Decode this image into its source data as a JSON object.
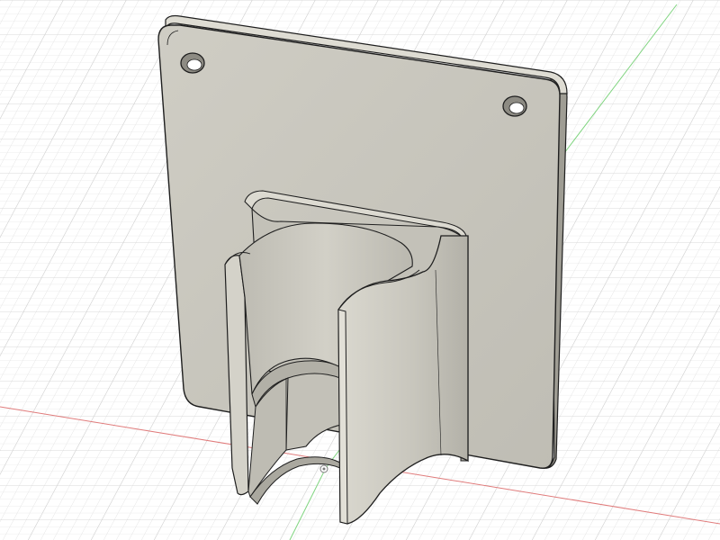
{
  "viewport": {
    "background": "#ffffff",
    "grid_minor_color": "#e3e3e3",
    "grid_major_color": "#cfcfcf",
    "x_axis_color": "#e07b7b",
    "y_axis_color": "#7fd47f"
  },
  "model": {
    "kind": "wall-mount pipe holder bracket",
    "face_color": "#c8c6bd",
    "face_light_color": "#d6d4cb",
    "face_dark_color": "#a9a79e",
    "edge_color": "#1f1f1f",
    "features": [
      "back-plate",
      "mounting-hole-left",
      "mounting-hole-right",
      "clip-cradle"
    ]
  },
  "origin_marker": {
    "icon": "origin-icon"
  }
}
